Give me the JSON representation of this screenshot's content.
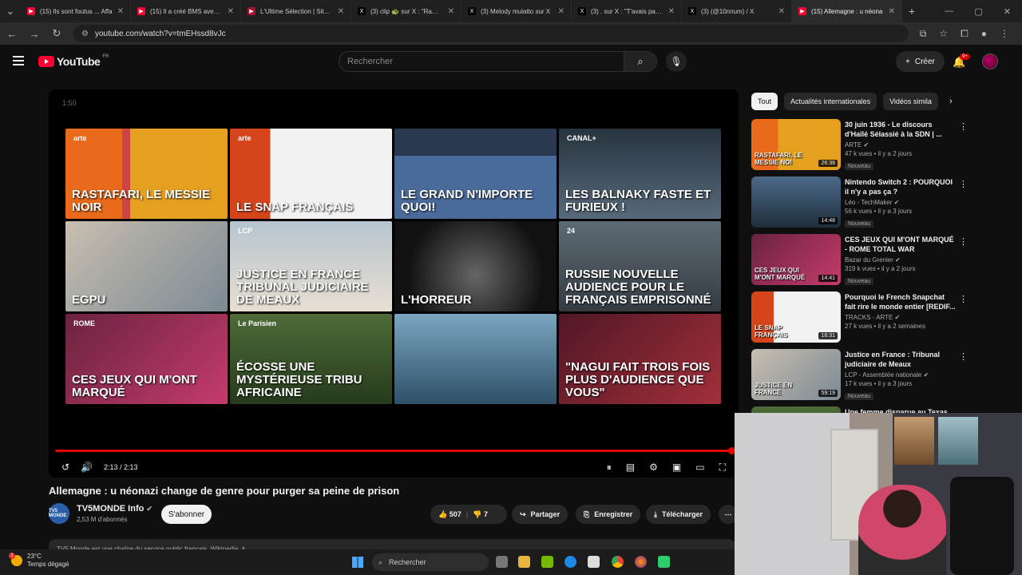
{
  "browser": {
    "tabs": [
      {
        "title": "(15) Ils sont foutus ... Affa",
        "icon": "youtube-icon",
        "color": "#ff0033"
      },
      {
        "title": "(15) Il a créé BMS avec 30",
        "icon": "youtube-icon",
        "color": "#ff0033"
      },
      {
        "title": "L'Ultime Sélection | Site o",
        "icon": "site-icon",
        "color": "#aa1133"
      },
      {
        "title": "(3) clip 🐢 sur X : \"Rampe",
        "icon": "x-icon",
        "color": "#000000"
      },
      {
        "title": "(3) Melody mulatto sur X",
        "icon": "x-icon",
        "color": "#000000"
      },
      {
        "title": "(3) . sur X : \"T'avais pas l'e",
        "icon": "x-icon",
        "color": "#000000"
      },
      {
        "title": "(3) (@10nnum) / X",
        "icon": "x-icon",
        "color": "#000000"
      },
      {
        "title": "(15) Allemagne : u néona",
        "icon": "youtube-icon",
        "color": "#ff0033",
        "active": true
      }
    ],
    "url": "youtube.com/watch?v=tmEHssd8vJc"
  },
  "header": {
    "logo": "YouTube",
    "country": "FR",
    "search_placeholder": "Rechercher",
    "create_label": "Créer",
    "notif_count": "9+"
  },
  "player": {
    "end_label": "1:50",
    "time": "2:13 / 2:13",
    "progress": 1.0,
    "endscreen": [
      {
        "caption": "Rastafari, le messie noir",
        "tag": "arte"
      },
      {
        "caption": "Le snap français",
        "tag": "arte"
      },
      {
        "caption": "Le grand n'importe quoi!",
        "tag": ""
      },
      {
        "caption": "Les Balnaky faste et furieux !",
        "tag": "CANAL+"
      },
      {
        "caption": "eGPU",
        "tag": ""
      },
      {
        "caption": "Justice en France tribunal judiciaire de Meaux",
        "tag": "LCP"
      },
      {
        "caption": "L'horreur",
        "tag": ""
      },
      {
        "caption": "Russie Nouvelle audience pour le Français emprisonné",
        "tag": "24"
      },
      {
        "caption": "Ces jeux qui m'ont marqué",
        "tag": "ROME"
      },
      {
        "caption": "Écosse Une mystérieuse tribu africaine",
        "tag": "Le Parisien"
      },
      {
        "caption": "",
        "tag": ""
      },
      {
        "caption": "\"Nagui fait trois fois plus d'audience que vous\"",
        "tag": ""
      }
    ]
  },
  "video": {
    "title": "Allemagne : u néonazi change de genre pour purger sa peine de prison",
    "channel": "TV5MONDE Info",
    "channel_avatar": "TV5 MONDE",
    "subscribers": "2,53 M d'abonnés",
    "subscribe_label": "S'abonner",
    "likes": "507",
    "dislikes": "7",
    "share_label": "Partager",
    "save_label": "Enregistrer",
    "download_label": "Télécharger",
    "description": "TV5 Monde est une chaîne du service public français. Wikipedia ↗"
  },
  "chips": [
    "Tout",
    "Actualités internationales",
    "Vidéos simila"
  ],
  "sidebar": [
    {
      "title": "30 juin 1936 - Le discours d'Haïlé Sélassié à la SDN | ...",
      "channel": "ARTE",
      "meta": "47 k vues • il y a 2 jours",
      "duration": "26:38",
      "caption": "Rastafari, le messie noi",
      "badge": "Nouveau"
    },
    {
      "title": "Nintendo Switch 2 : POURQUOI il n'y a pas ça ?",
      "channel": "Léo - TechMaker",
      "meta": "56 k vues • il y a 3 jours",
      "duration": "14:48",
      "caption": "",
      "badge": "Nouveau"
    },
    {
      "title": "CES JEUX QUI M'ONT MARQUÉ - ROME TOTAL WAR",
      "channel": "Bazar du Grenier",
      "meta": "319 k vues • il y a 2 jours",
      "duration": "14:41",
      "caption": "Ces jeux qui m'ont marqué",
      "badge": "Nouveau"
    },
    {
      "title": "Pourquoi le French Snapchat fait rire le monde entier [REDIF...",
      "channel": "TRACKS - ARTE",
      "meta": "27 k vues • il y a 2 semaines",
      "duration": "16:31",
      "caption": "Le snap français",
      "badge": ""
    },
    {
      "title": "Justice en France : Tribunal judiciaire de Meaux",
      "channel": "LCP - Assemblée nationale",
      "meta": "17 k vues • il y a 3 jours",
      "duration": "59:19",
      "caption": "Justice en France",
      "badge": "Nouveau"
    },
    {
      "title": "Une femme disparue au Texas",
      "channel": "",
      "meta": "",
      "duration": "",
      "caption": "",
      "badge": ""
    }
  ],
  "taskbar": {
    "temperature": "23°C",
    "weather": "Temps dégagé",
    "weather_alert": "1",
    "search_label": "Rechercher"
  }
}
